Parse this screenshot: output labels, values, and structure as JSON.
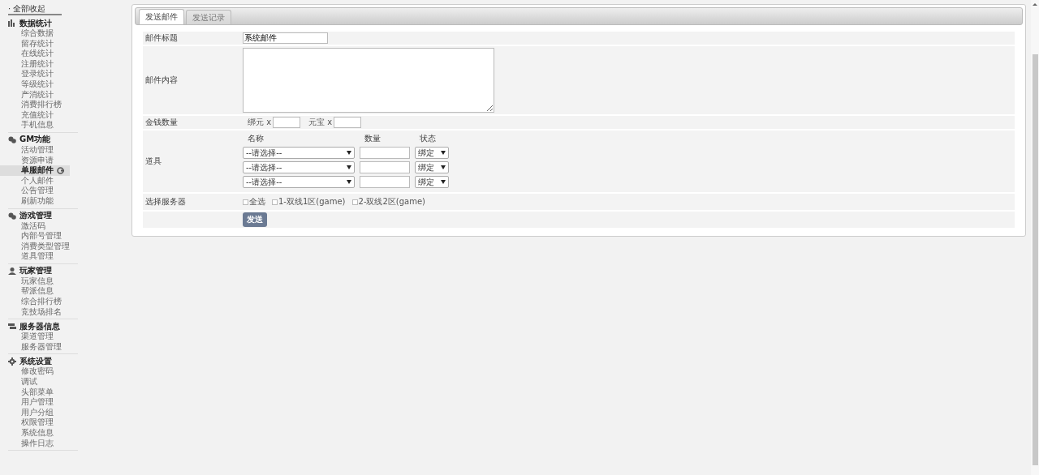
{
  "sidebar": {
    "collapse_link": "· 全部收起",
    "groups": [
      {
        "title": "数据统计",
        "items": [
          {
            "label": "综合数据",
            "selected": false
          },
          {
            "label": "留存统计",
            "selected": false
          },
          {
            "label": "在线统计",
            "selected": false
          },
          {
            "label": "注册统计",
            "selected": false
          },
          {
            "label": "登录统计",
            "selected": false
          },
          {
            "label": "等级统计",
            "selected": false
          },
          {
            "label": "产消统计",
            "selected": false
          },
          {
            "label": "消费排行榜",
            "selected": false
          },
          {
            "label": "充值统计",
            "selected": false
          },
          {
            "label": "手机信息",
            "selected": false
          }
        ]
      },
      {
        "title": "GM功能",
        "items": [
          {
            "label": "活动管理",
            "selected": false
          },
          {
            "label": "资源申请",
            "selected": false
          },
          {
            "label": "单服邮件",
            "selected": true
          },
          {
            "label": "个人邮件",
            "selected": false
          },
          {
            "label": "公告管理",
            "selected": false
          },
          {
            "label": "刷新功能",
            "selected": false
          }
        ]
      },
      {
        "title": "游戏管理",
        "items": [
          {
            "label": "激活码",
            "selected": false
          },
          {
            "label": "内部号管理",
            "selected": false
          },
          {
            "label": "消费类型管理",
            "selected": false
          },
          {
            "label": "道具管理",
            "selected": false
          }
        ]
      },
      {
        "title": "玩家管理",
        "items": [
          {
            "label": "玩家信息",
            "selected": false
          },
          {
            "label": "帮派信息",
            "selected": false
          },
          {
            "label": "综合排行榜",
            "selected": false
          },
          {
            "label": "竞技场排名",
            "selected": false
          }
        ]
      },
      {
        "title": "服务器信息",
        "items": [
          {
            "label": "渠道管理",
            "selected": false
          },
          {
            "label": "服务器管理",
            "selected": false
          }
        ]
      },
      {
        "title": "系统设置",
        "items": [
          {
            "label": "修改密码",
            "selected": false
          },
          {
            "label": "调试",
            "selected": false
          },
          {
            "label": "头部菜单",
            "selected": false
          },
          {
            "label": "用户管理",
            "selected": false
          },
          {
            "label": "用户分组",
            "selected": false
          },
          {
            "label": "权限管理",
            "selected": false
          },
          {
            "label": "系统信息",
            "selected": false
          },
          {
            "label": "操作日志",
            "selected": false
          }
        ]
      }
    ]
  },
  "tabs": [
    {
      "label": "发送邮件",
      "selected": true
    },
    {
      "label": "发送记录",
      "selected": false
    }
  ],
  "form": [
    {
      "kind": "text",
      "label": "邮件标题",
      "value": "系统邮件"
    },
    {
      "kind": "textarea",
      "label": "邮件内容"
    },
    {
      "kind": "money",
      "label": "金钱数量",
      "fields": [
        {
          "label": "绑元 x"
        },
        {
          "label": "元宝 x"
        }
      ]
    },
    {
      "kind": "items",
      "label": "道具",
      "columns": [
        "名称",
        "数量",
        "状态"
      ],
      "rows": [
        {
          "name": "--请选择--",
          "status": "绑定"
        },
        {
          "name": "--请选择--",
          "status": "绑定"
        },
        {
          "name": "--请选择--",
          "status": "绑定"
        }
      ]
    },
    {
      "kind": "servers",
      "label": "选择服务器",
      "options": [
        {
          "label": "全选",
          "checked": false
        },
        {
          "label": "1-双线1区(game)",
          "checked": false
        },
        {
          "label": "2-双线2区(game)",
          "checked": false
        }
      ]
    },
    {
      "kind": "submit",
      "button": "发送"
    }
  ]
}
